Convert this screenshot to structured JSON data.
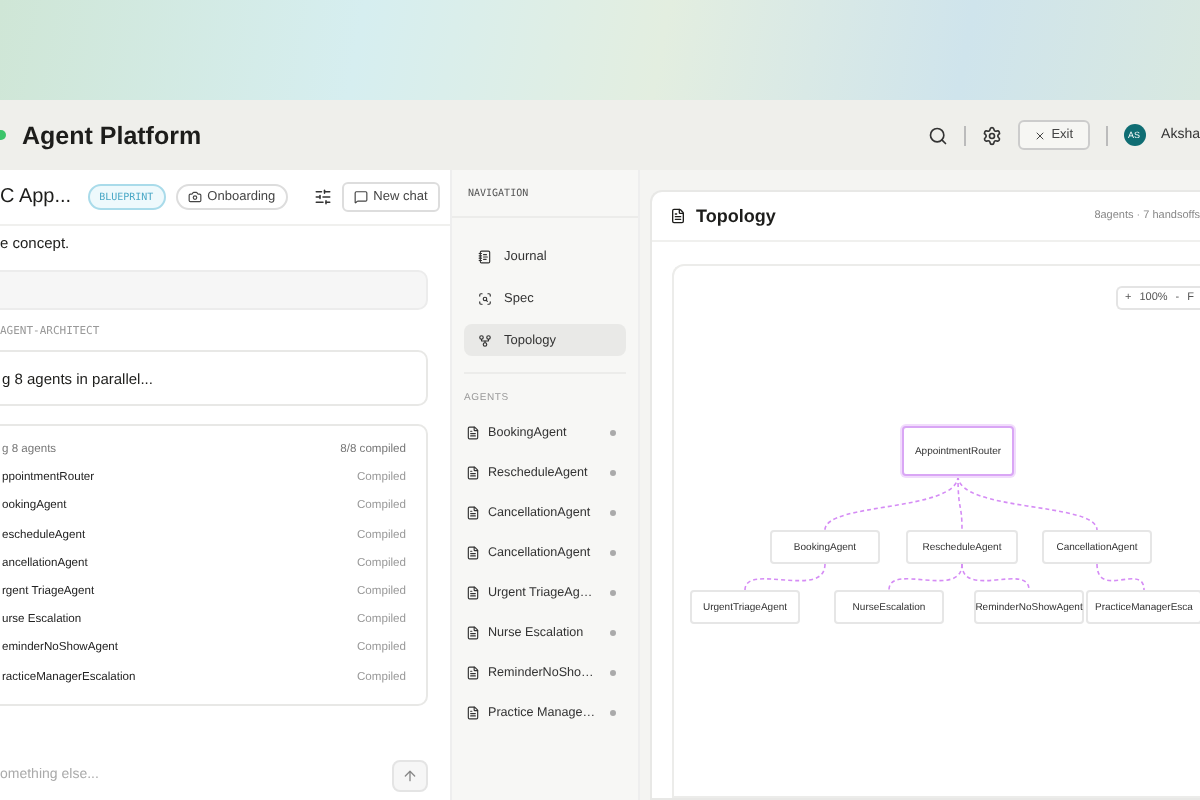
{
  "header": {
    "title": "Agent Platform",
    "exit": "Exit",
    "user_initials": "AS",
    "user_name": "Aksha"
  },
  "chat": {
    "title": "C App...",
    "badge": "BLUEPRINT",
    "onboarding": "Onboarding",
    "new_chat": "New chat",
    "message": "e concept.",
    "section_label": "AGENT-ARCHITECT",
    "status": "g 8 agents in parallel...",
    "compile": {
      "title": "g 8 agents",
      "summary": "8/8 compiled",
      "rows": [
        {
          "name": "ppointmentRouter",
          "status": "Compiled"
        },
        {
          "name": "ookingAgent",
          "status": "Compiled"
        },
        {
          "name": "escheduleAgent",
          "status": "Compiled"
        },
        {
          "name": "ancellationAgent",
          "status": "Compiled"
        },
        {
          "name": "rgent TriageAgent",
          "status": "Compiled"
        },
        {
          "name": "urse Escalation",
          "status": "Compiled"
        },
        {
          "name": "eminderNoShowAgent",
          "status": "Compiled"
        },
        {
          "name": "racticeManagerEscalation",
          "status": "Compiled"
        }
      ]
    },
    "input": {
      "placeholder": "omething else..."
    }
  },
  "navigation": {
    "heading": "NAVIGATION",
    "items": [
      {
        "label": "Journal",
        "kind": "journal",
        "selected": false
      },
      {
        "label": "Spec",
        "kind": "spec",
        "selected": false
      },
      {
        "label": "Topology",
        "kind": "topology",
        "selected": true
      }
    ],
    "agents_heading": "AGENTS",
    "agents": [
      "BookingAgent",
      "RescheduleAgent",
      "CancellationAgent",
      "CancellationAgent",
      "Urgent TriageAg…",
      "Nurse Escalation",
      "ReminderNoSho…",
      "Practice Manage…"
    ]
  },
  "topology": {
    "title": "Topology",
    "summary": "8agents · 7 handsoffs",
    "zoom": "100%",
    "zoom_in": "+",
    "zoom_out": "-",
    "fit": "F",
    "root": {
      "name": "AppointmentRouter",
      "selected": true,
      "children": [
        {
          "name": "BookingAgent",
          "selected": false,
          "children": [
            {
              "name": "UrgentTriageAgent",
              "selected": false
            }
          ]
        },
        {
          "name": "RescheduleAgent",
          "selected": false,
          "children": [
            {
              "name": "NurseEscalation",
              "selected": false
            },
            {
              "name": "ReminderNoShowAgent",
              "selected": false
            }
          ]
        },
        {
          "name": "CancellationAgent",
          "selected": false,
          "children": [
            {
              "name": "PracticeManagerEsca",
              "selected": false
            }
          ]
        }
      ]
    }
  }
}
